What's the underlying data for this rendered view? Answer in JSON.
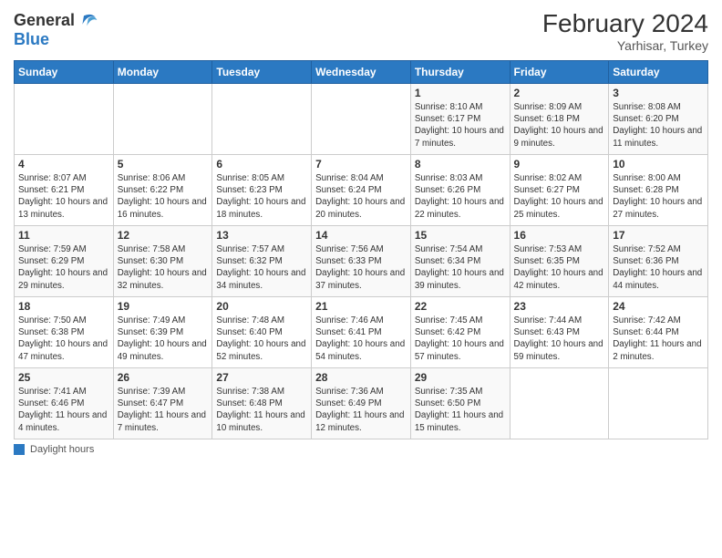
{
  "header": {
    "logo_general": "General",
    "logo_blue": "Blue",
    "title": "February 2024",
    "subtitle": "Yarhisar, Turkey"
  },
  "days_of_week": [
    "Sunday",
    "Monday",
    "Tuesday",
    "Wednesday",
    "Thursday",
    "Friday",
    "Saturday"
  ],
  "footer": {
    "label": "Daylight hours"
  },
  "weeks": [
    {
      "days": [
        {
          "number": "",
          "info": ""
        },
        {
          "number": "",
          "info": ""
        },
        {
          "number": "",
          "info": ""
        },
        {
          "number": "",
          "info": ""
        },
        {
          "number": "1",
          "info": "Sunrise: 8:10 AM\nSunset: 6:17 PM\nDaylight: 10 hours and 7 minutes."
        },
        {
          "number": "2",
          "info": "Sunrise: 8:09 AM\nSunset: 6:18 PM\nDaylight: 10 hours and 9 minutes."
        },
        {
          "number": "3",
          "info": "Sunrise: 8:08 AM\nSunset: 6:20 PM\nDaylight: 10 hours and 11 minutes."
        }
      ]
    },
    {
      "days": [
        {
          "number": "4",
          "info": "Sunrise: 8:07 AM\nSunset: 6:21 PM\nDaylight: 10 hours and 13 minutes."
        },
        {
          "number": "5",
          "info": "Sunrise: 8:06 AM\nSunset: 6:22 PM\nDaylight: 10 hours and 16 minutes."
        },
        {
          "number": "6",
          "info": "Sunrise: 8:05 AM\nSunset: 6:23 PM\nDaylight: 10 hours and 18 minutes."
        },
        {
          "number": "7",
          "info": "Sunrise: 8:04 AM\nSunset: 6:24 PM\nDaylight: 10 hours and 20 minutes."
        },
        {
          "number": "8",
          "info": "Sunrise: 8:03 AM\nSunset: 6:26 PM\nDaylight: 10 hours and 22 minutes."
        },
        {
          "number": "9",
          "info": "Sunrise: 8:02 AM\nSunset: 6:27 PM\nDaylight: 10 hours and 25 minutes."
        },
        {
          "number": "10",
          "info": "Sunrise: 8:00 AM\nSunset: 6:28 PM\nDaylight: 10 hours and 27 minutes."
        }
      ]
    },
    {
      "days": [
        {
          "number": "11",
          "info": "Sunrise: 7:59 AM\nSunset: 6:29 PM\nDaylight: 10 hours and 29 minutes."
        },
        {
          "number": "12",
          "info": "Sunrise: 7:58 AM\nSunset: 6:30 PM\nDaylight: 10 hours and 32 minutes."
        },
        {
          "number": "13",
          "info": "Sunrise: 7:57 AM\nSunset: 6:32 PM\nDaylight: 10 hours and 34 minutes."
        },
        {
          "number": "14",
          "info": "Sunrise: 7:56 AM\nSunset: 6:33 PM\nDaylight: 10 hours and 37 minutes."
        },
        {
          "number": "15",
          "info": "Sunrise: 7:54 AM\nSunset: 6:34 PM\nDaylight: 10 hours and 39 minutes."
        },
        {
          "number": "16",
          "info": "Sunrise: 7:53 AM\nSunset: 6:35 PM\nDaylight: 10 hours and 42 minutes."
        },
        {
          "number": "17",
          "info": "Sunrise: 7:52 AM\nSunset: 6:36 PM\nDaylight: 10 hours and 44 minutes."
        }
      ]
    },
    {
      "days": [
        {
          "number": "18",
          "info": "Sunrise: 7:50 AM\nSunset: 6:38 PM\nDaylight: 10 hours and 47 minutes."
        },
        {
          "number": "19",
          "info": "Sunrise: 7:49 AM\nSunset: 6:39 PM\nDaylight: 10 hours and 49 minutes."
        },
        {
          "number": "20",
          "info": "Sunrise: 7:48 AM\nSunset: 6:40 PM\nDaylight: 10 hours and 52 minutes."
        },
        {
          "number": "21",
          "info": "Sunrise: 7:46 AM\nSunset: 6:41 PM\nDaylight: 10 hours and 54 minutes."
        },
        {
          "number": "22",
          "info": "Sunrise: 7:45 AM\nSunset: 6:42 PM\nDaylight: 10 hours and 57 minutes."
        },
        {
          "number": "23",
          "info": "Sunrise: 7:44 AM\nSunset: 6:43 PM\nDaylight: 10 hours and 59 minutes."
        },
        {
          "number": "24",
          "info": "Sunrise: 7:42 AM\nSunset: 6:44 PM\nDaylight: 11 hours and 2 minutes."
        }
      ]
    },
    {
      "days": [
        {
          "number": "25",
          "info": "Sunrise: 7:41 AM\nSunset: 6:46 PM\nDaylight: 11 hours and 4 minutes."
        },
        {
          "number": "26",
          "info": "Sunrise: 7:39 AM\nSunset: 6:47 PM\nDaylight: 11 hours and 7 minutes."
        },
        {
          "number": "27",
          "info": "Sunrise: 7:38 AM\nSunset: 6:48 PM\nDaylight: 11 hours and 10 minutes."
        },
        {
          "number": "28",
          "info": "Sunrise: 7:36 AM\nSunset: 6:49 PM\nDaylight: 11 hours and 12 minutes."
        },
        {
          "number": "29",
          "info": "Sunrise: 7:35 AM\nSunset: 6:50 PM\nDaylight: 11 hours and 15 minutes."
        },
        {
          "number": "",
          "info": ""
        },
        {
          "number": "",
          "info": ""
        }
      ]
    }
  ]
}
